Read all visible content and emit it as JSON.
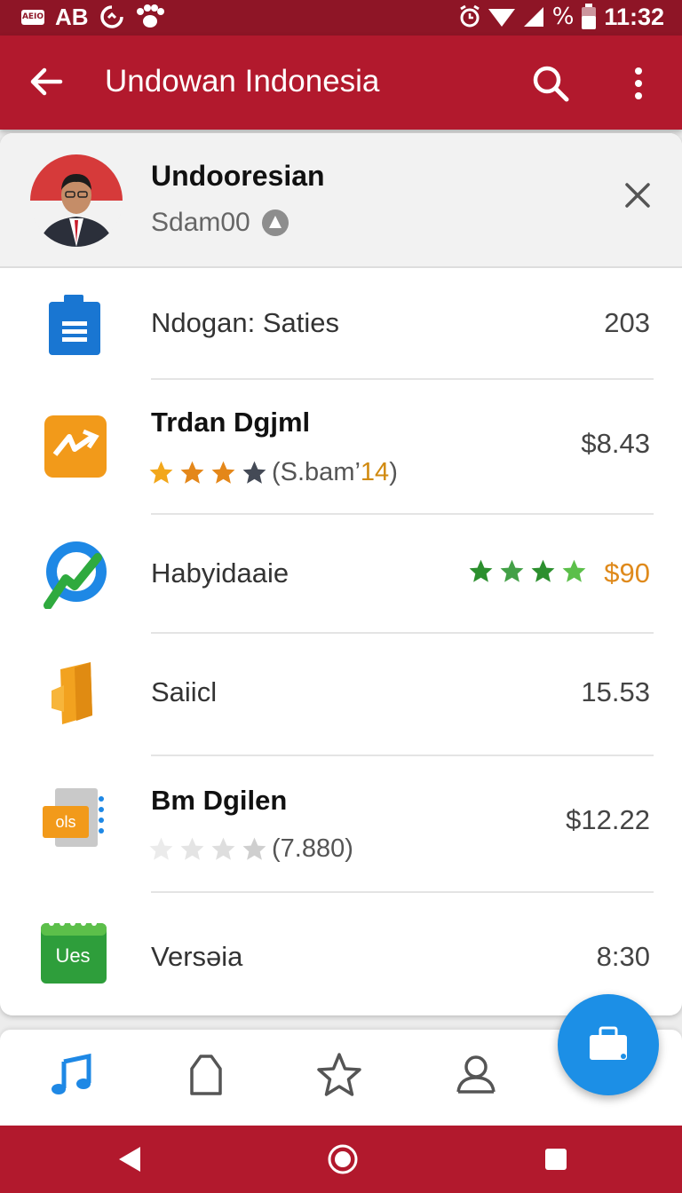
{
  "status_bar": {
    "box_label": "AEIO",
    "left_text": "AB",
    "right_signal": "%",
    "time": "11:32"
  },
  "app_bar": {
    "title": "Undowan Indonesia",
    "icons": [
      "back-arrow-icon",
      "search-icon",
      "more-vert-icon"
    ]
  },
  "profile": {
    "name": "Undooresian",
    "subtitle": "Sdam00"
  },
  "items": [
    {
      "title": "Ndogan: Saties",
      "value": "203",
      "icon": "document-icon",
      "icon_color": "#1976d2"
    },
    {
      "title": "Trdan Dgjml",
      "value": "$8.43",
      "rating": 4,
      "rating_prefix": "(S.bam’ ",
      "rating_count": "14",
      "rating_suffix": ")",
      "icon": "play-forward-icon",
      "icon_color": "#f29a1a"
    },
    {
      "title": "Habyidaaie",
      "value": "$90",
      "stars": 4,
      "icon": "globe-check-icon",
      "icon_color": "#1e88e5"
    },
    {
      "title": "Saiicl",
      "value": "15.53",
      "icon": "cube-icon",
      "icon_color": "#f2a21f"
    },
    {
      "title": "Bm Dgilen",
      "value": "$12.22",
      "rating": 5,
      "rating_text": "(7.880)",
      "icon_label": "ols",
      "icon": "notebook-icon",
      "icon_color": "#f29a1a"
    },
    {
      "title": "Versəia",
      "value": "8:30",
      "icon_label": "Ues",
      "icon": "calendar-icon",
      "icon_color": "#2e9e3b"
    }
  ],
  "bottom_nav": [
    "music-icon",
    "bag-icon",
    "star-icon",
    "person-icon"
  ],
  "fab_icon": "briefcase-icon",
  "colors": {
    "primary": "#b2192d",
    "status_bar": "#8e1526",
    "accent": "#1c8fe6"
  }
}
